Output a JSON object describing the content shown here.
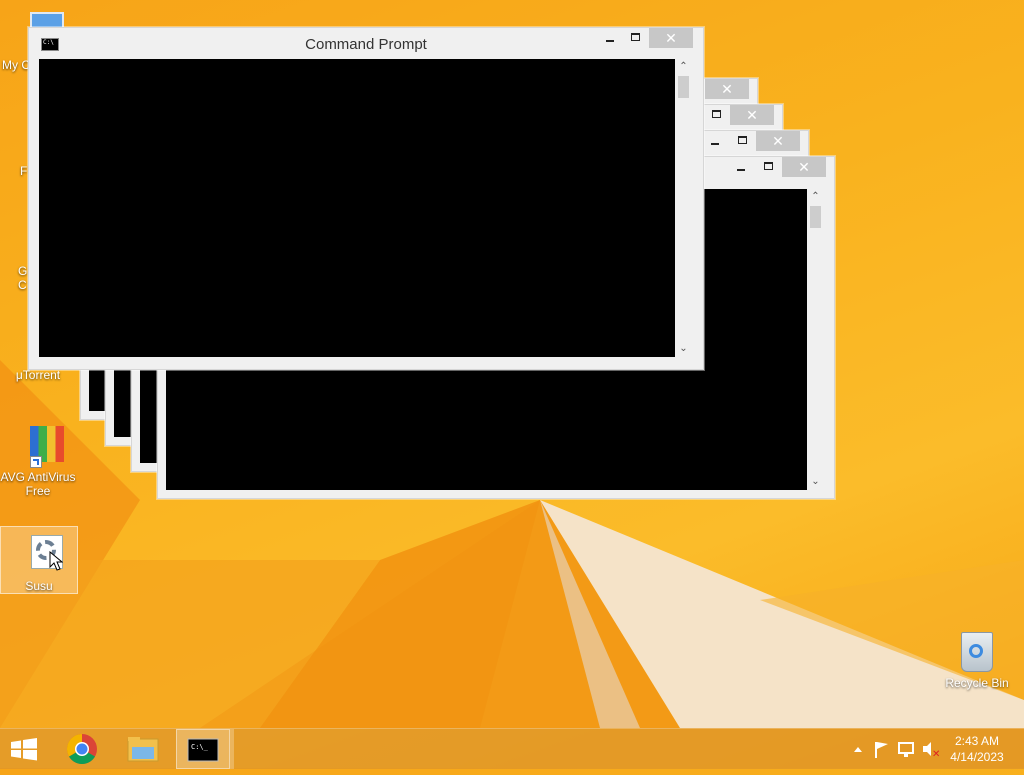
{
  "desktop_icons": [
    {
      "label": "My C",
      "name": "my-computer"
    },
    {
      "label": "F",
      "name": "firefox"
    },
    {
      "label": "G\nC",
      "name": "google-chrome"
    },
    {
      "label": "μTorrent",
      "name": "utorrent"
    },
    {
      "label": "AVG AntiVirus\nFree",
      "name": "avg-antivirus-free"
    },
    {
      "label": "Susu",
      "name": "susu"
    },
    {
      "label": "Recycle Bin",
      "name": "recycle-bin"
    }
  ],
  "front_window": {
    "title": "Command Prompt",
    "buttons": {
      "minimize": "minimize",
      "maximize": "maximize",
      "close": "✕"
    },
    "scroll_up": "⌃",
    "scroll_down": "⌄"
  },
  "back_windows": {
    "close_glyph": "✕",
    "scroll_down": "⌄"
  },
  "taskbar": {
    "start_icon": "windows-logo-icon",
    "pinned": [
      {
        "name": "chrome",
        "icon": "chrome-icon"
      },
      {
        "name": "file-explorer",
        "icon": "folder-icon"
      },
      {
        "name": "command-prompt",
        "icon": "cmd-icon",
        "active": true
      }
    ],
    "tray_icons": [
      "show-hidden-icons-icon",
      "action-center-flag-icon",
      "network-icon",
      "volume-muted-icon"
    ],
    "time": "2:43 AM",
    "date": "4/14/2023"
  },
  "colors": {
    "wallpaper": "#f9b21e",
    "console_bg": "#000000",
    "window_frame": "#f0f0f0",
    "close_button": "#c7c7c7"
  }
}
